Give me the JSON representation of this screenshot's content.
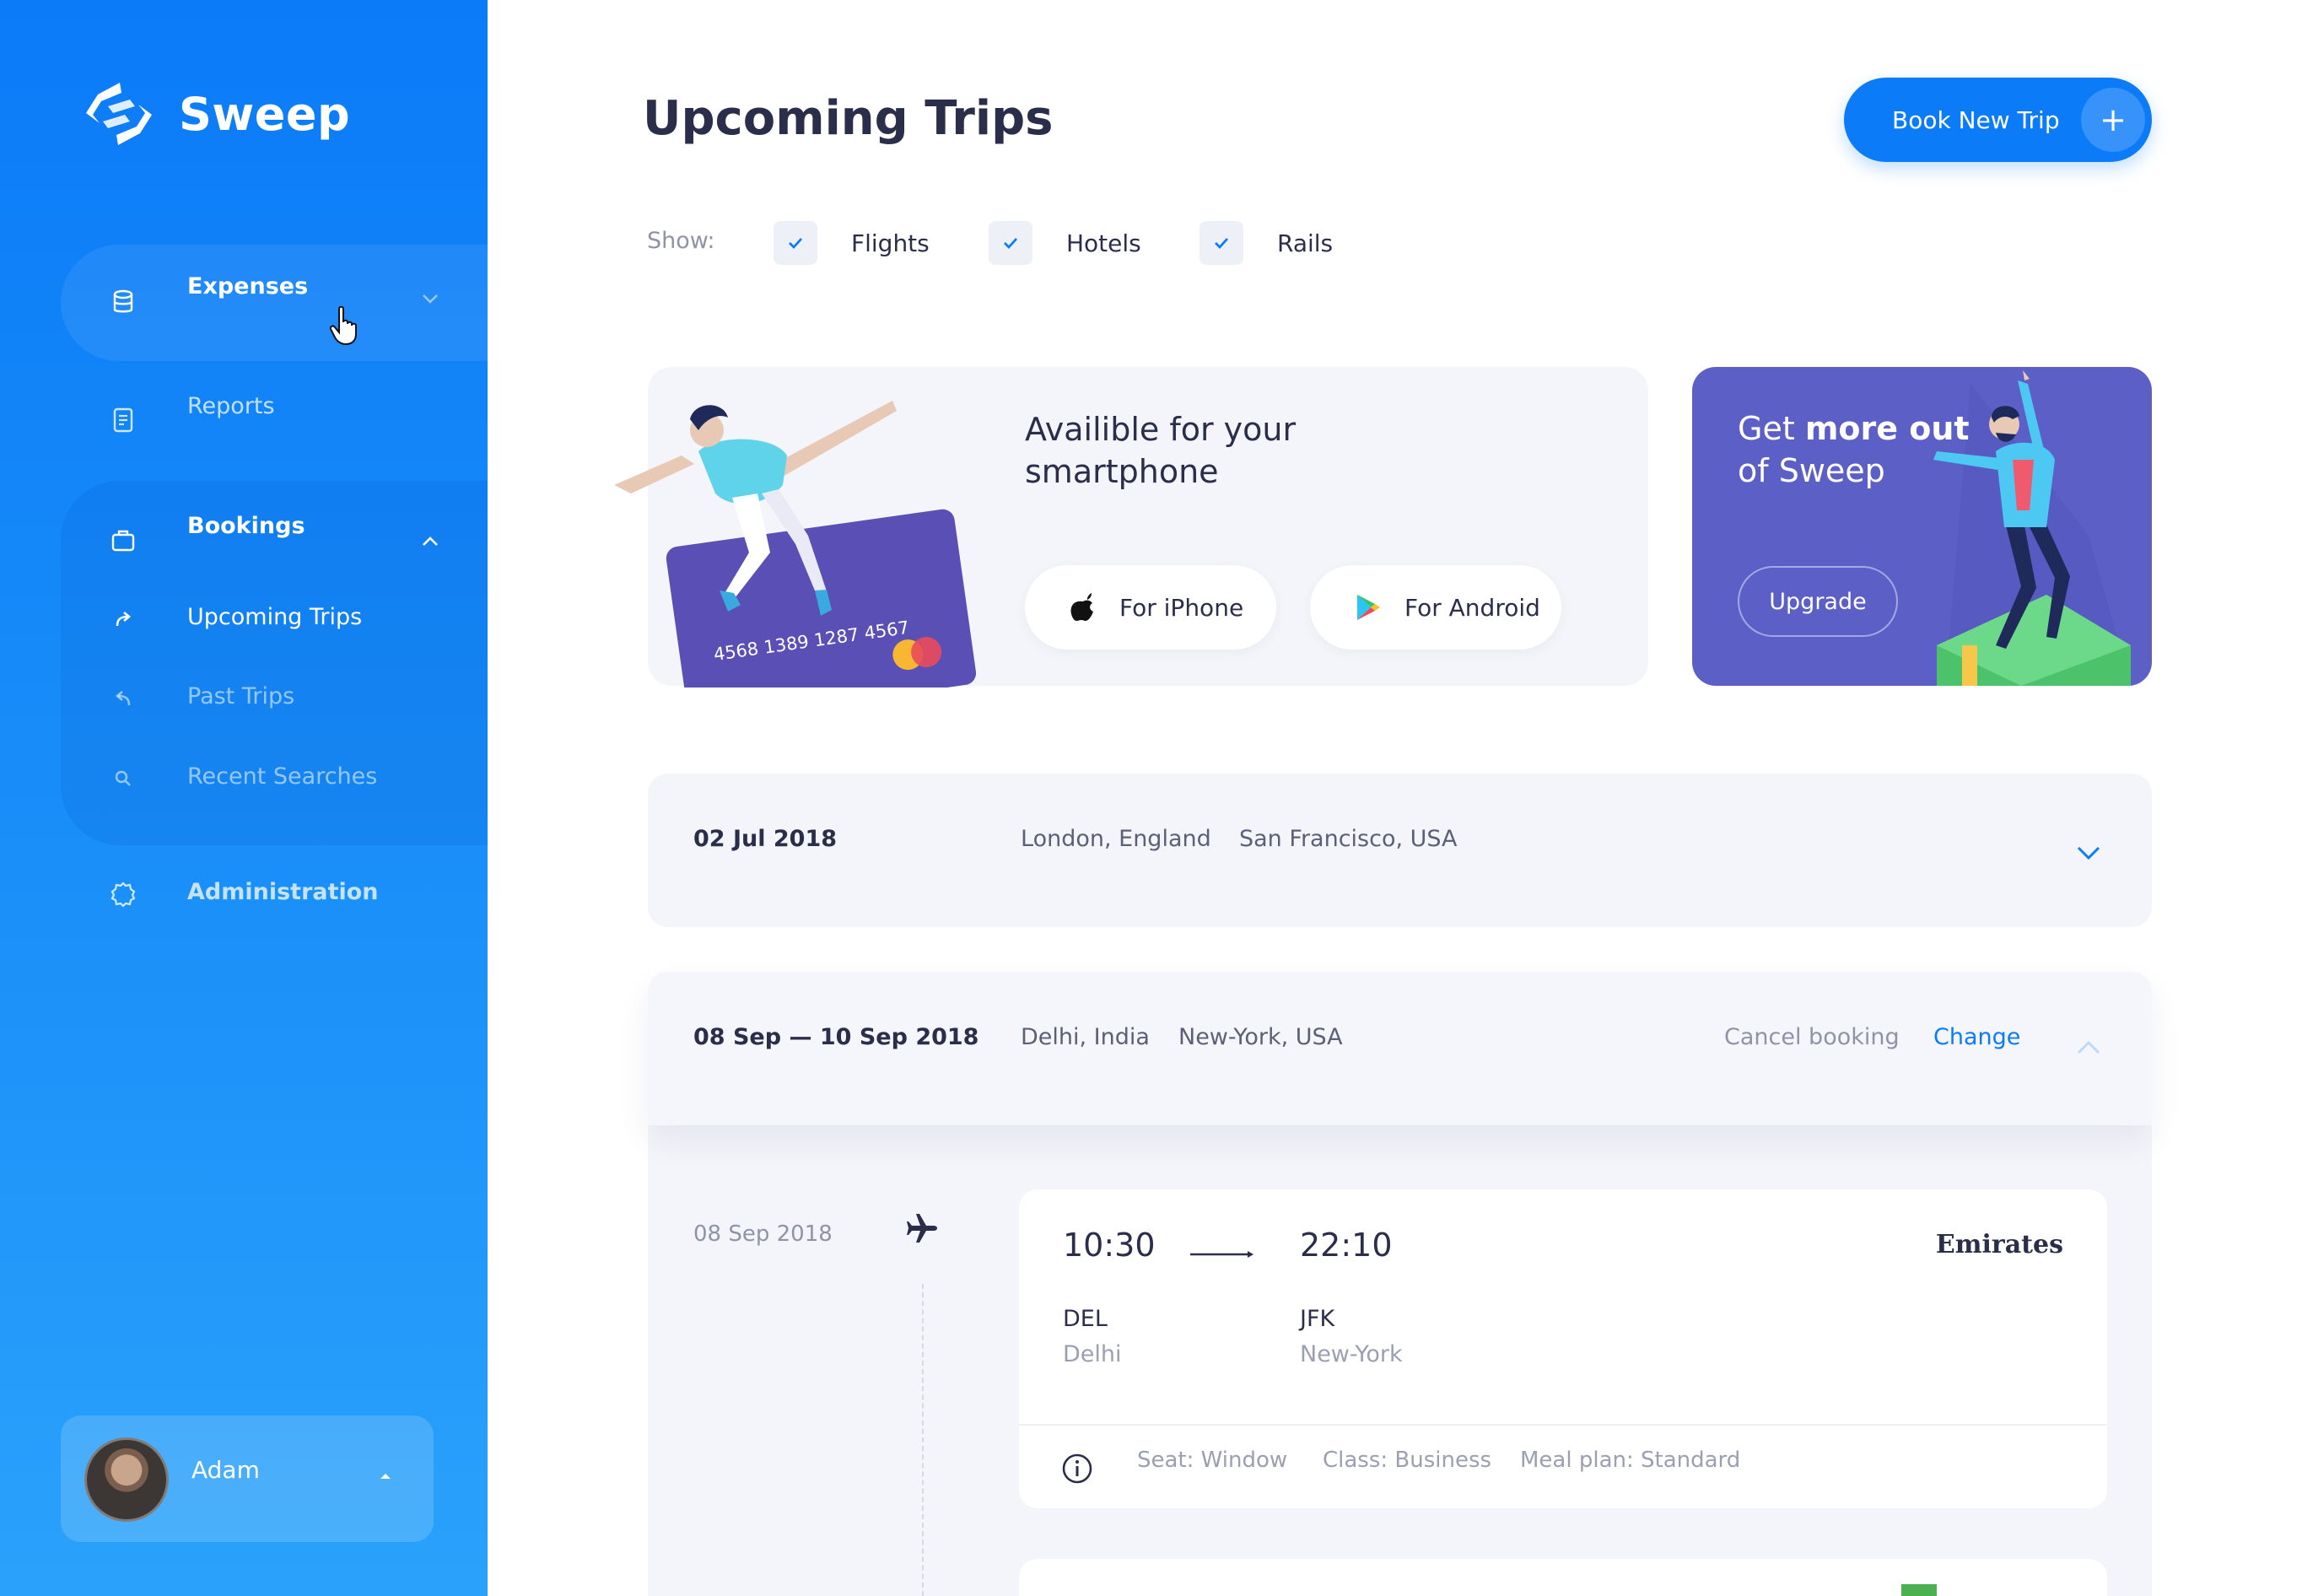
{
  "app": {
    "name": "Sweep"
  },
  "sidebar": {
    "items": [
      {
        "label": "Expenses",
        "icon": "database-icon"
      },
      {
        "label": "Reports",
        "icon": "document-icon"
      },
      {
        "label": "Bookings",
        "icon": "briefcase-icon"
      },
      {
        "label": "Upcoming Trips",
        "icon": "forward-arrow-icon"
      },
      {
        "label": "Past Trips",
        "icon": "reply-arrow-icon"
      },
      {
        "label": "Recent Searches",
        "icon": "search-icon"
      },
      {
        "label": "Administration",
        "icon": "gear-icon"
      }
    ]
  },
  "user": {
    "name": "Adam"
  },
  "header": {
    "title": "Upcoming Trips",
    "book_button": "Book New Trip"
  },
  "filters": {
    "show_label": "Show:",
    "options": [
      {
        "label": "Flights",
        "checked": true
      },
      {
        "label": "Hotels",
        "checked": true
      },
      {
        "label": "Rails",
        "checked": true
      }
    ]
  },
  "promo_app": {
    "title_line1": "Availible for your",
    "title_line2": "smartphone",
    "iphone_label": "For iPhone",
    "android_label": "For Android",
    "card_number": "4568 1389 1287 4567"
  },
  "promo_upgrade": {
    "title_pre": "Get ",
    "title_bold": "more out",
    "title_line2": "of Sweep",
    "button": "Upgrade"
  },
  "trips": [
    {
      "date": "02 Jul 2018",
      "from": "London, England",
      "to": "San Francisco, USA"
    },
    {
      "date": "08 Sep — 10 Sep 2018",
      "from": "Delhi, India",
      "to": "New-York, USA",
      "cancel_label": "Cancel booking",
      "change_label": "Change",
      "segment": {
        "date": "08 Sep 2018",
        "depart_time": "10:30",
        "arrive_time": "22:10",
        "from_code": "DEL",
        "from_city": "Delhi",
        "to_code": "JFK",
        "to_city": "New-York",
        "airline": "Emirates",
        "seat": "Seat: Window",
        "class": "Class: Business",
        "meal": "Meal plan: Standard"
      }
    }
  ],
  "colors": {
    "accent": "#0b7bf8",
    "upgrade_bg": "#5c5fc6",
    "card_bg": "#f4f5fa"
  }
}
